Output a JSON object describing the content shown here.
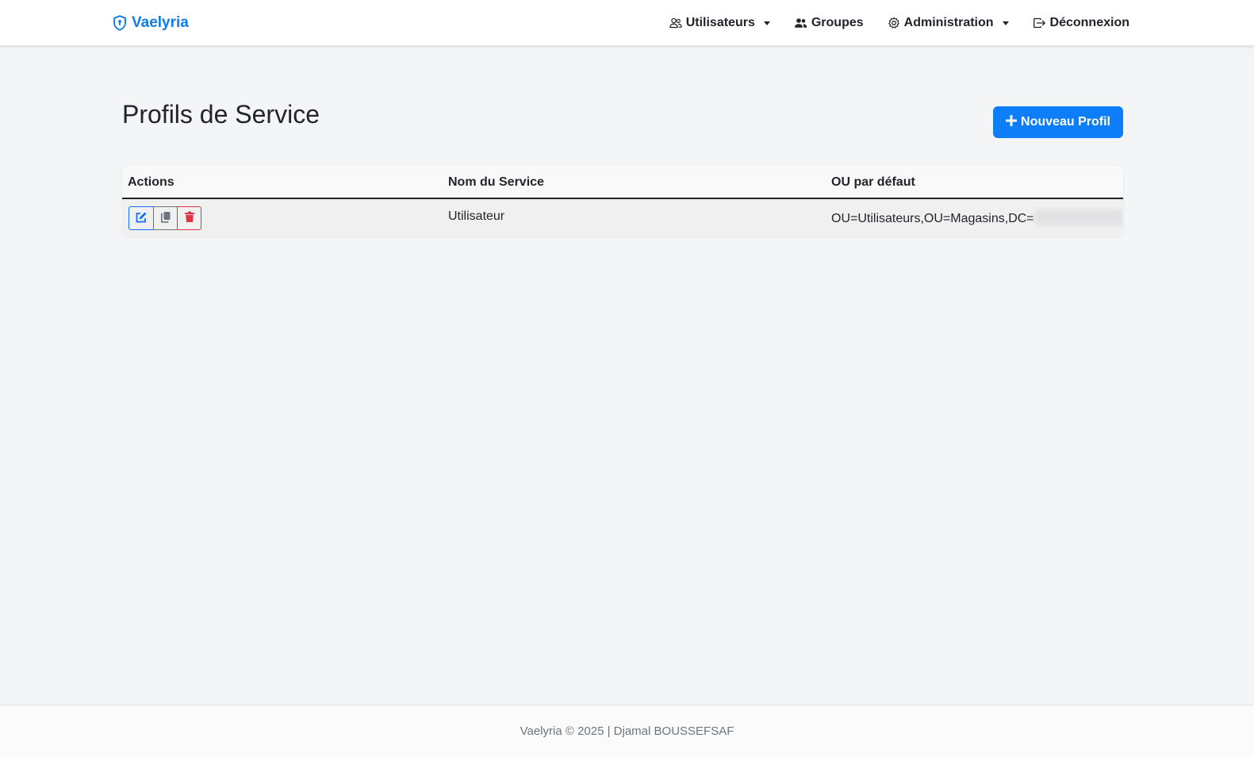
{
  "brand": {
    "name": "Vaelyria",
    "icon": "shield-icon",
    "color": "#0d7ee8"
  },
  "nav": {
    "users": {
      "label": "Utilisateurs",
      "icon": "users-outline-icon"
    },
    "groups": {
      "label": "Groupes",
      "icon": "people-fill-icon"
    },
    "admin": {
      "label": "Administration",
      "icon": "gear-icon"
    },
    "logout": {
      "label": "Déconnexion",
      "icon": "box-arrow-right-icon"
    }
  },
  "page": {
    "title": "Profils de Service",
    "new_button_label": "Nouveau Profil",
    "new_button_icon": "plus-icon",
    "accent_color": "#0d7ef8"
  },
  "table": {
    "headers": [
      "Actions",
      "Nom du Service",
      "OU par défaut"
    ],
    "rows": [
      {
        "service_name": "Utilisateur",
        "default_ou": "OU=Utilisateurs,OU=Magasins,DC=",
        "actions": [
          "edit-icon",
          "copy-icon",
          "trash-icon"
        ]
      }
    ]
  },
  "footer": {
    "text": "Vaelyria © 2025 | Djamal BOUSSEFSAF"
  }
}
